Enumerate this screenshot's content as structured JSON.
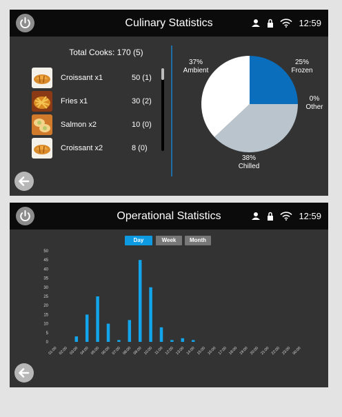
{
  "culinary": {
    "title": "Culinary Statistics",
    "time": "12:59",
    "total_cooks": "Total Cooks: 170 (5)",
    "items": [
      {
        "name": "Croissant x1",
        "count": "50 (1)",
        "icon": "croissant-icon"
      },
      {
        "name": "Fries x1",
        "count": "30 (2)",
        "icon": "fries-icon"
      },
      {
        "name": "Salmon x2",
        "count": "10 (0)",
        "icon": "salmon-icon"
      },
      {
        "name": "Croissant x2",
        "count": "8 (0)",
        "icon": "croissant-icon"
      }
    ],
    "chart_data": {
      "type": "pie",
      "slices": [
        {
          "label": "Frozen",
          "percent_label": "25%",
          "value": 25,
          "color": "#0a6ebd"
        },
        {
          "label": "Other",
          "percent_label": "0%",
          "value": 0,
          "color": "#888888"
        },
        {
          "label": "Chilled",
          "percent_label": "38%",
          "value": 38,
          "color": "#b9c4cc"
        },
        {
          "label": "Ambient",
          "percent_label": "37%",
          "value": 37,
          "color": "#ffffff"
        }
      ]
    }
  },
  "operational": {
    "title": "Operational Statistics",
    "time": "12:59",
    "tabs": [
      {
        "label": "Day",
        "active": true
      },
      {
        "label": "Week",
        "active": false
      },
      {
        "label": "Month",
        "active": false
      }
    ],
    "chart_data": {
      "type": "bar",
      "categories": [
        "01:00",
        "02:00",
        "03:00",
        "04:00",
        "05:00",
        "06:00",
        "07:00",
        "08:00",
        "09:00",
        "10:00",
        "11:00",
        "12:00",
        "13:00",
        "14:00",
        "15:00",
        "16:00",
        "17:00",
        "18:00",
        "19:00",
        "20:00",
        "21:00",
        "22:00",
        "23:00",
        "00:00"
      ],
      "values": [
        0,
        0,
        3,
        15,
        25,
        10,
        1,
        12,
        45,
        30,
        8,
        1,
        2,
        1,
        0,
        0,
        0,
        0,
        0,
        0,
        0,
        0,
        0,
        0
      ],
      "yticks": [
        0,
        5,
        10,
        15,
        20,
        25,
        30,
        35,
        40,
        45,
        50
      ],
      "ylim": [
        0,
        50
      ],
      "color": "#12a5ec"
    }
  },
  "colors": {
    "screen_bg": "#333333",
    "topbar_bg": "#0b0b0b",
    "accent": "#0e9ae0"
  }
}
